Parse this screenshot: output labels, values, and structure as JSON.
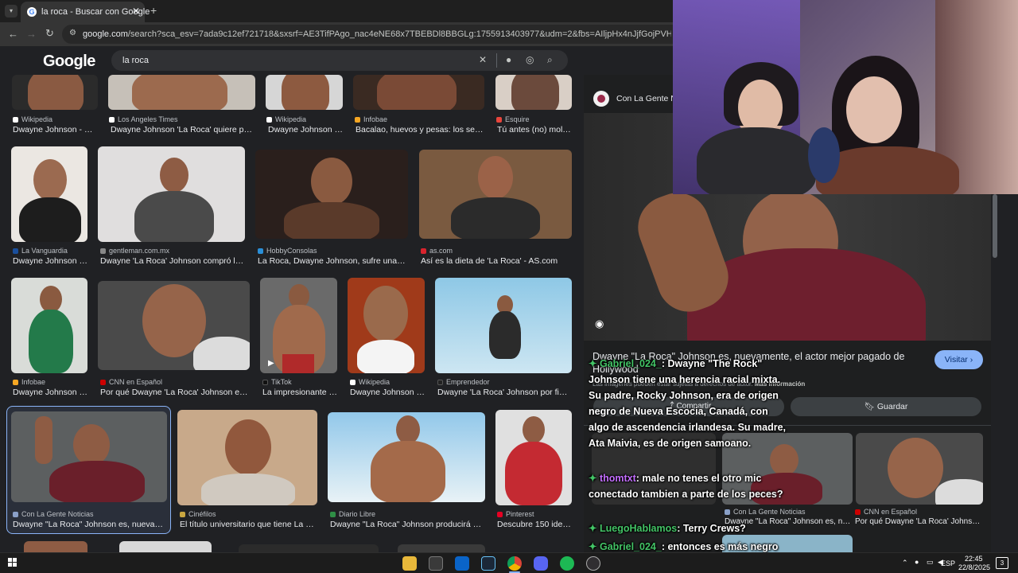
{
  "browser": {
    "tab_title": "la roca - Buscar con Google",
    "url_domain": "google.com",
    "url_rest": "/search?sca_esv=7ada9c12ef721718&sxsrf=AE3TifPAgo_nac4eNE68x7TBEBDl8BBGLg:1755913403977&udm=2&fbs=AIljpHx4nJjfGojPVHhEACUHPiMQht6_BFq6vBIoFFRK",
    "new_tab": "+",
    "close": "✕"
  },
  "google": {
    "logo": "Google",
    "query": "la roca",
    "colors": {
      "bg": "#202124",
      "text": "#e8eaed",
      "muted": "#bdc1c6"
    }
  },
  "results": [
    {
      "source": "Wikipedia",
      "title": "Dwayne Johnson - Wi...",
      "src_color": "#ffffff"
    },
    {
      "source": "Los Angeles Times",
      "title": "Dwayne Johnson 'La Roca' quiere pele...",
      "src_color": "#ffffff"
    },
    {
      "source": "Wikipedia",
      "title": "Dwayne Johnson - ...",
      "src_color": "#ffffff"
    },
    {
      "source": "Infobae",
      "title": "Bacalao, huevos y pesas: los secr...",
      "src_color": "#f5a623"
    },
    {
      "source": "Esquire",
      "title": "Tú antes (no) mola...",
      "src_color": "#e8453c"
    },
    {
      "source": "La Vanguardia",
      "title": "Dwayne Johnson -...",
      "src_color": "#1a4f9c"
    },
    {
      "source": "gentleman.com.mx",
      "title": "Dwayne 'La Roca' Johnson compró la li...",
      "src_color": "#888888"
    },
    {
      "source": "HobbyConsolas",
      "title": "La Roca, Dwayne Johnson, sufre una lesi...",
      "src_color": "#2a8fd8"
    },
    {
      "source": "as.com",
      "title": "Así es la dieta de 'La Roca' - AS.com",
      "src_color": "#d9232d"
    },
    {
      "source": "Infobae",
      "title": "Dwayne Johnson c...",
      "src_color": "#f5a623"
    },
    {
      "source": "CNN en Español",
      "title": "Por qué Dwayne 'La Roca' Johnson está ...",
      "src_color": "#cc0000"
    },
    {
      "source": "TikTok",
      "title": "La impresionante f...",
      "src_color": "#111111"
    },
    {
      "source": "Wikipedia",
      "title": "Dwayne Johnson -...",
      "src_color": "#ffffff"
    },
    {
      "source": "Emprendedor",
      "title": "Dwayne 'La Roca' Johnson por fin e...",
      "src_color": "#222222"
    },
    {
      "source": "Con La Gente Noticias",
      "title": "Dwayne \"La Roca\" Johnson es, nuevamen...",
      "src_color": "#8aa0c8"
    },
    {
      "source": "Cinéfilos",
      "title": "El título universitario que tiene La Ro...",
      "src_color": "#c9a640"
    },
    {
      "source": "Diario Libre",
      "title": "Dwayne \"La Roca\" Johnson producirá par...",
      "src_color": "#2f8f46"
    },
    {
      "source": "Pinterest",
      "title": "Descubre 150 idea...",
      "src_color": "#e60023"
    }
  ],
  "panel": {
    "source": "Con La Gente No",
    "description": "Dwayne \"La Roca\" Johnson es, nuevamente, el actor mejor pagado de Hollywood",
    "disclaimer": "Las imágenes pueden estar sujetas a derechos de autor.",
    "more_info": "Más información",
    "visit": "Visitar",
    "share": "Compartir",
    "save": "Guardar",
    "related": [
      {
        "source": "Con La Gente Noticias",
        "title": "Dwayne \"La Roca\" Johnson es, nu..."
      },
      {
        "source": "CNN en Español",
        "title": "Por qué Dwayne 'La Roca' Johnso..."
      }
    ]
  },
  "chat": [
    {
      "user": "Gabriel_024_",
      "text": ": Dwayne \"The Rock\" Johnson tiene una herencia racial mixta. Su padre, Rocky Johnson, era de origen negro de Nueva Escocia, Canadá, con algo de ascendencia irlandesa. Su madre, Ata Maivia, es de origen samoano."
    },
    {
      "user": "thomtxt",
      "text": ": male no tenes el otro mic conectado tambien a parte de los peces?"
    },
    {
      "user": "LuegoHablamos",
      "text": ": Terry Crews?"
    },
    {
      "user": "Gabriel_024_",
      "text": ": entonces es más negro que blanco"
    }
  ],
  "taskbar": {
    "lang": "ESP",
    "time": "22:45",
    "date": "22/8/2025",
    "notifications": "3"
  }
}
